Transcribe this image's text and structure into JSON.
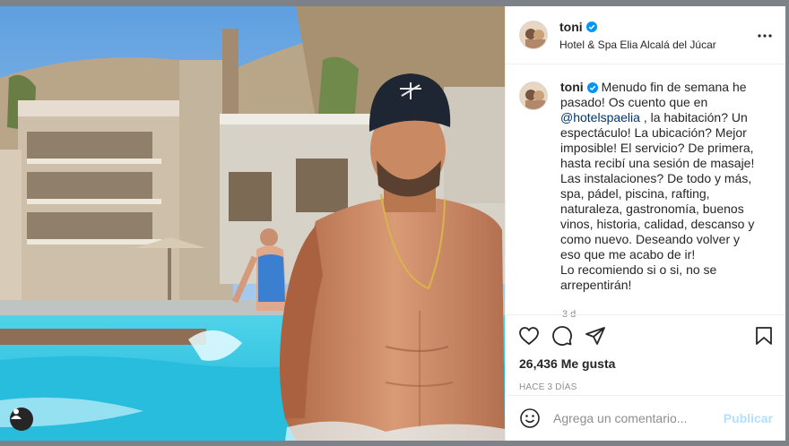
{
  "post": {
    "username": "toni",
    "location": "Hotel & Spa Elia Alcalá del Júcar",
    "caption_user": "toni",
    "caption_before_mention": "Menudo fin de semana he pasado! Os cuento que en ",
    "mention": "@hotelspaelia",
    "caption_after_mention": " , la habitación? Un espectáculo! La ubicación? Mejor imposible! El servicio? De primera, hasta recibí una sesión de masaje! Las instalaciones? De todo y más, spa, pádel, piscina, rafting, naturaleza, gastronomía, buenos vinos, historia, calidad, descanso y como nuevo. Deseando volver y eso que me acabo de ir!",
    "caption_line2": "Lo recomiendo si o si, no se arrepentirán!",
    "caption_time": "3 d",
    "likes": "26,436 Me gusta",
    "date": "HACE 3 DÍAS"
  },
  "comment_box": {
    "placeholder": "Agrega un comentario...",
    "publish_label": "Publicar"
  },
  "icons": {
    "like": "heart-icon",
    "comment": "comment-bubble-icon",
    "share": "paper-plane-icon",
    "save": "bookmark-icon",
    "emoji": "smiley-icon",
    "more": "ellipsis-icon",
    "verified": "verified-badge-icon",
    "user_tag": "user-tag-icon"
  },
  "colors": {
    "verified": "#0095f6",
    "publish_disabled": "#b2dffc",
    "mention": "#00376b"
  }
}
